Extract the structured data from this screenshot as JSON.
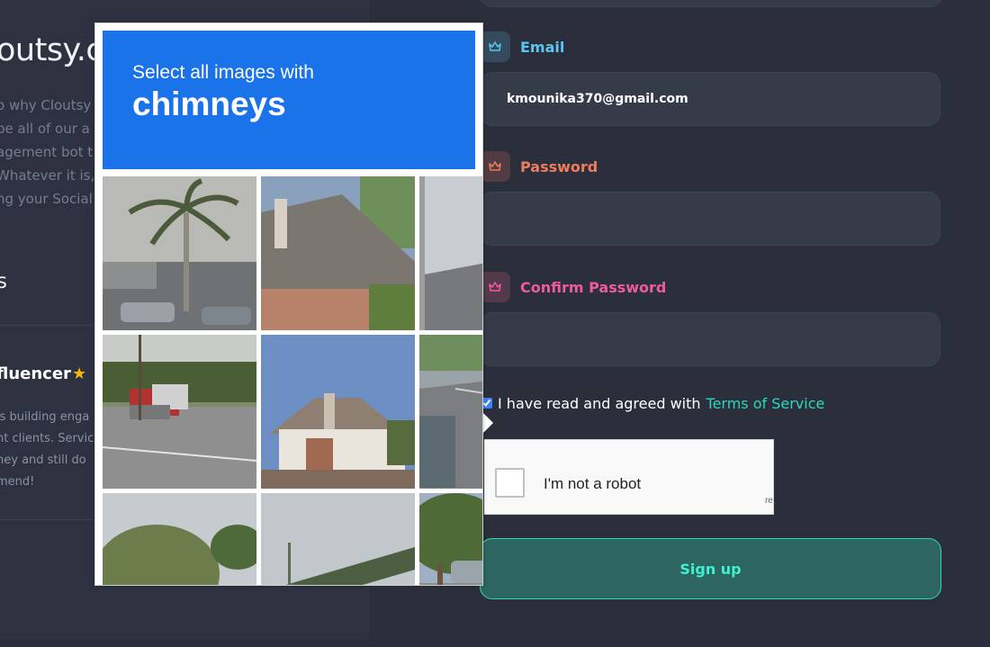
{
  "left_panel": {
    "brand": "outsy.c",
    "intro_lines": [
      "o why Cloutsy i",
      "be all of our a",
      "agement bot t",
      "Whatever it is,",
      "ng your Social"
    ],
    "section_title": "s",
    "review": {
      "name": "fluencer",
      "star": "★",
      "text_lines": [
        "is building enga",
        "nt clients. Servic",
        "ney and still do",
        "mend!"
      ]
    }
  },
  "form": {
    "email": {
      "label": "Email",
      "value": "kmounika370@gmail.com",
      "color": "#5bc6f0"
    },
    "password": {
      "label": "Password",
      "value": "",
      "color": "#f07c5c"
    },
    "confirm_password": {
      "label": "Confirm Password",
      "value": "",
      "color": "#ef5aa0"
    },
    "terms_text": "I have read and agreed with",
    "terms_link": "Terms of Service",
    "signup_label": "Sign up"
  },
  "recaptcha": {
    "checkbox_label": "I'm not a robot",
    "tiny_text": "re"
  },
  "challenge": {
    "line1": "Select all images with",
    "keyword": "chimneys",
    "header_color": "#1a73e8",
    "tiles": [
      {
        "name": "tile-palm-parking"
      },
      {
        "name": "tile-house-chimney"
      },
      {
        "name": "tile-roof-edge"
      },
      {
        "name": "tile-road-trucks"
      },
      {
        "name": "tile-house-chimney-2"
      },
      {
        "name": "tile-road-car"
      },
      {
        "name": "tile-trees"
      },
      {
        "name": "tile-overpass"
      },
      {
        "name": "tile-trees-cars"
      }
    ]
  }
}
